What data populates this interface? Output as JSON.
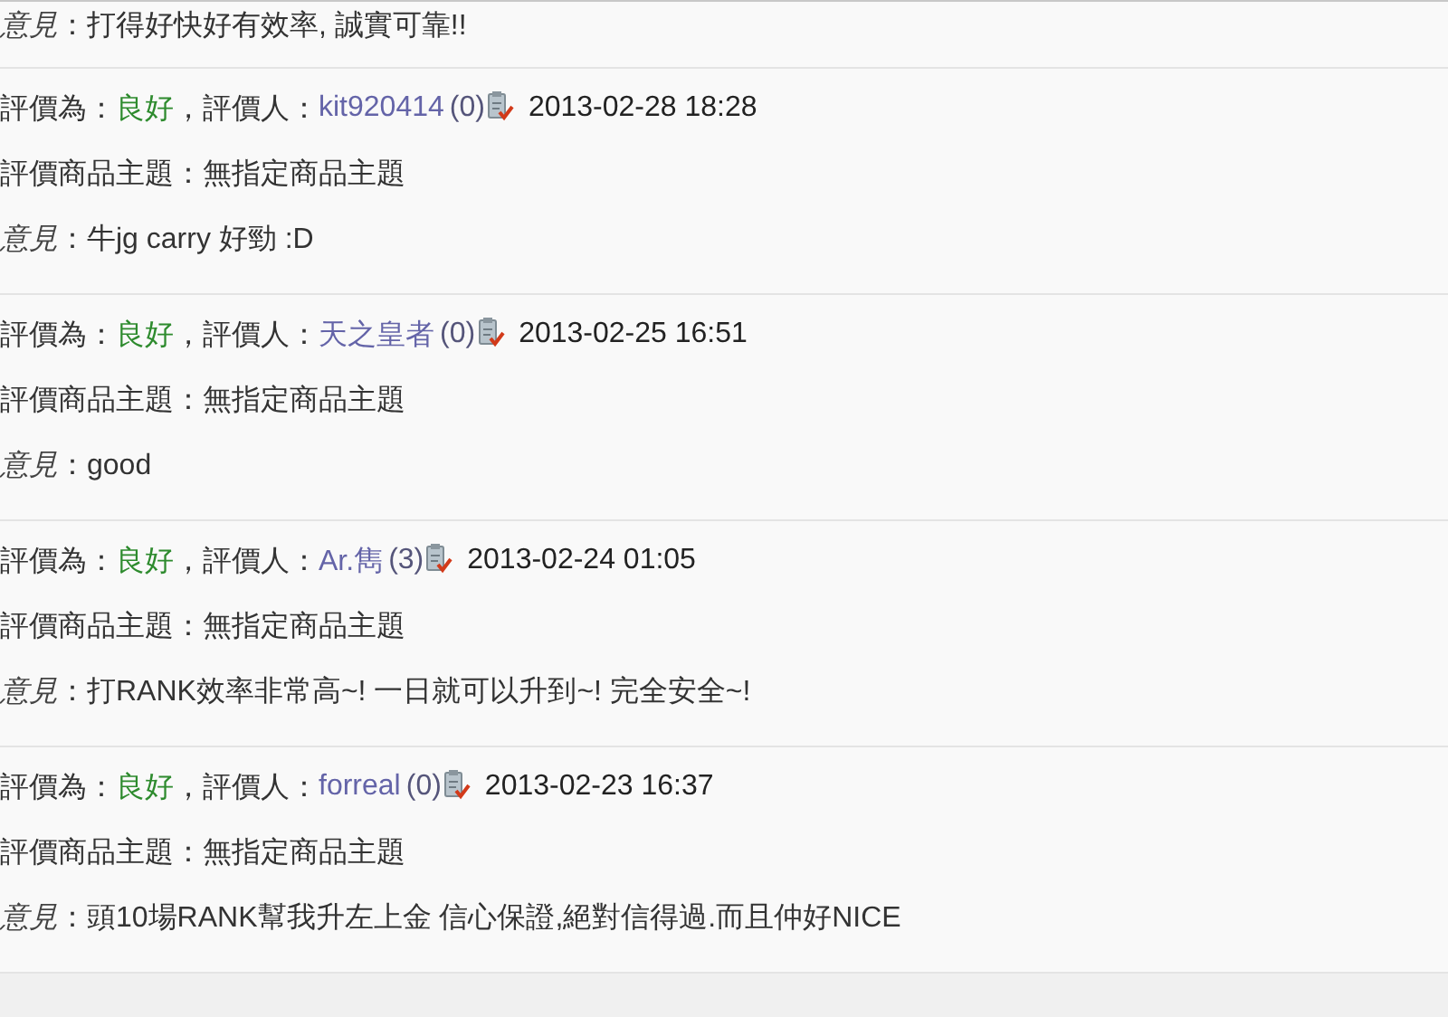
{
  "entries": [
    {
      "opinion_label": "意見",
      "opinion": "：打得好快好有效率, 誠實可靠!!"
    },
    {
      "rating_label": "評價為：",
      "rating": "良好",
      "rater_label": "，評價人：",
      "rater": "kit920414",
      "rater_count": "(0)",
      "date": "2013-02-28 18:28",
      "subject": "評價商品主題：無指定商品主題",
      "opinion_label": "意見",
      "opinion": "：牛jg carry 好勁 :D"
    },
    {
      "rating_label": "評價為：",
      "rating": "良好",
      "rater_label": "，評價人：",
      "rater": "天之皇者",
      "rater_count": "(0)",
      "date": "2013-02-25 16:51",
      "subject": "評價商品主題：無指定商品主題",
      "opinion_label": "意見",
      "opinion": "：good"
    },
    {
      "rating_label": "評價為：",
      "rating": "良好",
      "rater_label": "，評價人：",
      "rater": "Ar.雋",
      "rater_count": "(3)",
      "date": "2013-02-24 01:05",
      "subject": "評價商品主題：無指定商品主題",
      "opinion_label": "意見",
      "opinion": "：打RANK效率非常高~! 一日就可以升到~! 完全安全~!"
    },
    {
      "rating_label": "評價為：",
      "rating": "良好",
      "rater_label": "，評價人：",
      "rater": "forreal",
      "rater_count": "(0)",
      "date": "2013-02-23 16:37",
      "subject": "評價商品主題：無指定商品主題",
      "opinion_label": "意見",
      "opinion": "：頭10場RANK幫我升左上金 信心保證,絕對信得過.而且仲好NICE"
    }
  ]
}
